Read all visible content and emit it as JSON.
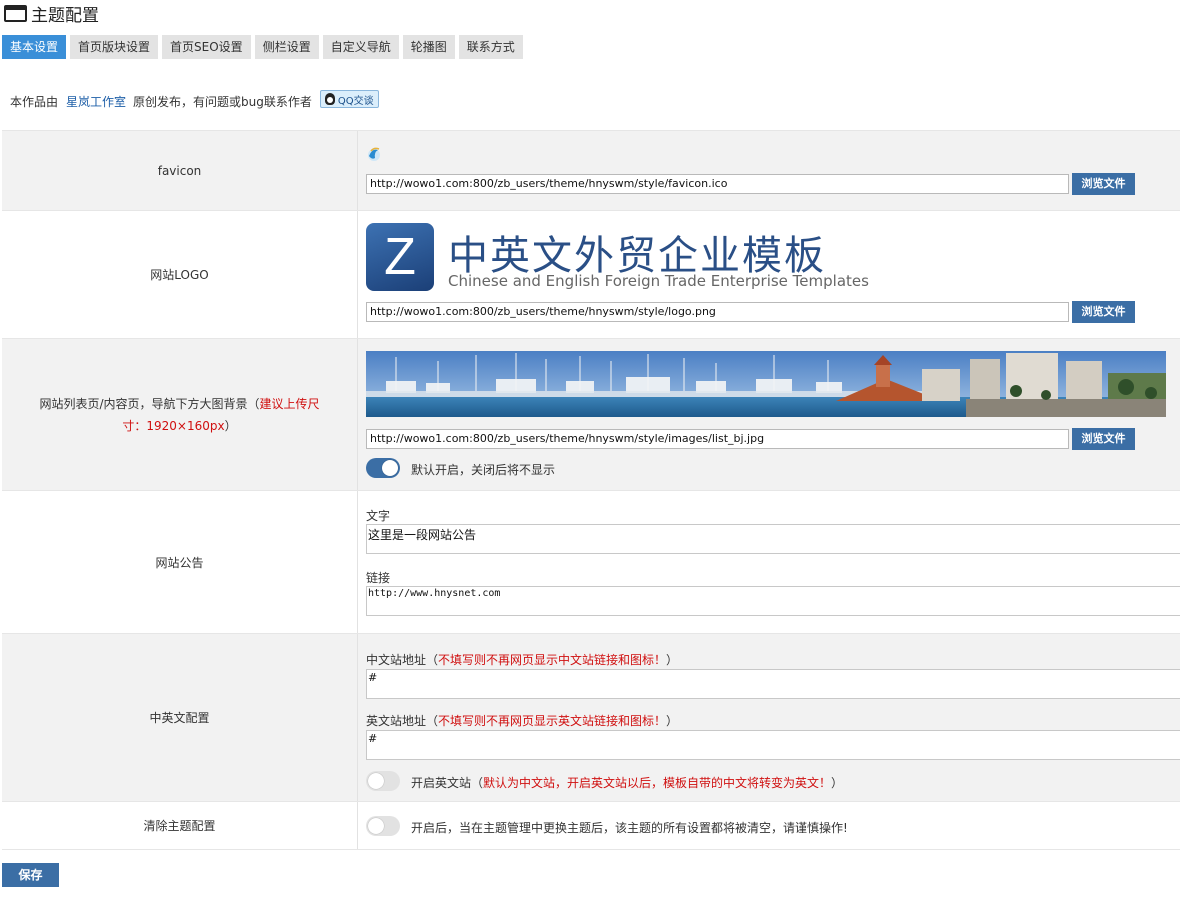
{
  "page": {
    "title": "主题配置"
  },
  "tabs": [
    {
      "label": "基本设置",
      "active": true
    },
    {
      "label": "首页版块设置",
      "active": false
    },
    {
      "label": "首页SEO设置",
      "active": false
    },
    {
      "label": "侧栏设置",
      "active": false
    },
    {
      "label": "自定义导航",
      "active": false
    },
    {
      "label": "轮播图",
      "active": false
    },
    {
      "label": "联系方式",
      "active": false
    }
  ],
  "credit": {
    "prefix": "本作品由",
    "studio": "星岚工作室",
    "suffix": "原创发布，有问题或bug联系作者",
    "qq_label": "QQ交谈"
  },
  "browse_label": "浏览文件",
  "favicon": {
    "label": "favicon",
    "url": "http://wowo1.com:800/zb_users/theme/hnyswm/style/favicon.ico"
  },
  "logo": {
    "label": "网站LOGO",
    "url": "http://wowo1.com:800/zb_users/theme/hnyswm/style/logo.png",
    "letter": "Z",
    "title_cn": "中英文外贸企业模板",
    "title_en": "Chinese and English Foreign Trade Enterprise Templates"
  },
  "banner": {
    "label": "网站列表页/内容页，导航下方大图背景（",
    "hint": "建议上传尺寸：1920×160px",
    "close": "）",
    "url": "http://wowo1.com:800/zb_users/theme/hnyswm/style/images/list_bj.jpg",
    "toggle_label": "默认开启，关闭后将不显示",
    "enabled": true
  },
  "notice": {
    "label": "网站公告",
    "text_label": "文字",
    "text_value": "这里是一段网站公告",
    "link_label": "链接",
    "link_value": "http://www.hnysnet.com"
  },
  "lang": {
    "label": "中英文配置",
    "cn_label": "中文站地址（",
    "cn_hint": "不填写则不再网页显示中文站链接和图标！",
    "cn_close": "）",
    "cn_value": "#",
    "en_label": "英文站地址（",
    "en_hint": "不填写则不再网页显示英文站链接和图标！",
    "en_close": "）",
    "en_value": "#",
    "toggle_label": "开启英文站（",
    "toggle_hint": "默认为中文站，开启英文站以后，模板自带的中文将转变为英文！",
    "toggle_close": "）",
    "enabled": false
  },
  "clear": {
    "label": "清除主题配置",
    "hint": "开启后，当在主题管理中更换主题后，该主题的所有设置都将被清空，请谨慎操作!",
    "enabled": false
  },
  "save_label": "保存"
}
